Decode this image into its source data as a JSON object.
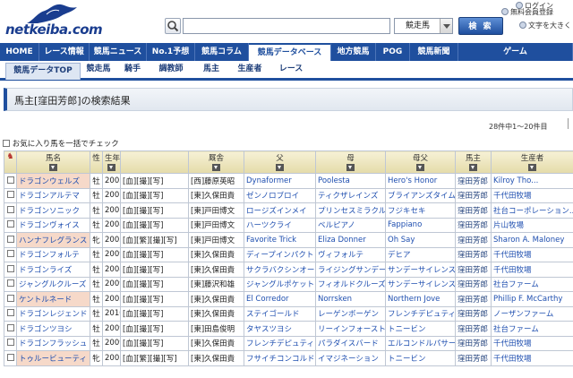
{
  "header": {
    "logo_text": "netkeiba.com",
    "search_placeholder": "",
    "search_select": "競走馬",
    "search_button": "検 索",
    "login_link": "ログイン",
    "member_link": "無料会員登録",
    "font_link": "文字を大きく"
  },
  "main_nav": [
    {
      "label": "HOME",
      "width": 44
    },
    {
      "label": "レース情報",
      "width": 56
    },
    {
      "label": "競馬ニュース",
      "width": 64
    },
    {
      "label": "No.1予想",
      "width": 54
    },
    {
      "label": "競馬コラム",
      "width": 60
    },
    {
      "label": "競馬データベース",
      "width": 92,
      "active": true
    },
    {
      "label": "地方競馬",
      "width": 50
    },
    {
      "label": "POG",
      "width": 38
    },
    {
      "label": "競馬新聞",
      "width": 54
    },
    {
      "label": "ゲーム",
      "width": 128
    }
  ],
  "sub_nav": [
    {
      "label": "競馬データTOP",
      "width": 84,
      "active": true
    },
    {
      "label": "競走馬",
      "width": 40
    },
    {
      "label": "騎手",
      "width": 36
    },
    {
      "label": "調教師",
      "width": 50
    },
    {
      "label": "馬主",
      "width": 40
    },
    {
      "label": "生産者",
      "width": 46
    },
    {
      "label": "レース",
      "width": 46
    }
  ],
  "page_title": "馬主[窪田芳郎]の検索結果",
  "count_text": "28件中1～20件目",
  "fav_check_label": "お気に入り馬を一括でチェック",
  "columns": [
    "馬名",
    "性",
    "生年",
    "",
    "厩舎",
    "父",
    "母",
    "母父",
    "馬主",
    "生産者"
  ],
  "rows": [
    {
      "name": "ドラゴンウェルズ",
      "sex": "牡",
      "year": "2003",
      "links": "[血][撮][写]",
      "trainer": "[西]藤原英昭",
      "sire": "Dynaformer",
      "dam": "Poolesta",
      "damsire": "Hero's Honor",
      "owner": "窪田芳郎",
      "breeder": "Kilroy Tho...",
      "mare_bg": true
    },
    {
      "name": "ドラゴンアルテマ",
      "sex": "牡",
      "year": "2007",
      "links": "[血][撮][写]",
      "trainer": "[東]久保田貴",
      "sire": "ゼンノロブロイ",
      "dam": "ティクザレインズ",
      "damsire": "ブライアンズタイム",
      "owner": "窪田芳郎",
      "breeder": "千代田牧場",
      "mare_bg": false
    },
    {
      "name": "ドラゴンソニック",
      "sex": "牡",
      "year": "2007",
      "links": "[血][撮][写]",
      "trainer": "[東]戸田博文",
      "sire": "ロージズインメイ",
      "dam": "プリンセスミラクル",
      "damsire": "フジキセキ",
      "owner": "窪田芳郎",
      "breeder": "社台コーポレーション...",
      "mare_bg": false
    },
    {
      "name": "ドラゴンヴォイス",
      "sex": "牡",
      "year": "2008",
      "links": "[血][撮][写]",
      "trainer": "[東]戸田博文",
      "sire": "ハーツクライ",
      "dam": "ベルピアノ",
      "damsire": "Fappiano",
      "owner": "窪田芳郎",
      "breeder": "片山牧場",
      "mare_bg": false
    },
    {
      "name": "ハンナフレグランス",
      "sex": "牝",
      "year": "2003",
      "links": "[血][繁][撮][写]",
      "trainer": "[東]戸田博文",
      "sire": "Favorite Trick",
      "dam": "Eliza Donner",
      "damsire": "Oh Say",
      "owner": "窪田芳郎",
      "breeder": "Sharon A. Maloney",
      "mare_bg": true
    },
    {
      "name": "ドラゴンフォルテ",
      "sex": "牡",
      "year": "2009",
      "links": "[血][撮][写]",
      "trainer": "[東]久保田貴",
      "sire": "ディープインパクト",
      "dam": "ヴィフォルテ",
      "damsire": "デヒア",
      "owner": "窪田芳郎",
      "breeder": "千代田牧場",
      "mare_bg": false
    },
    {
      "name": "ドラゴンライズ",
      "sex": "牡",
      "year": "2008",
      "links": "[血][撮][写]",
      "trainer": "[東]久保田貴",
      "sire": "サクラバクシンオー",
      "dam": "ライジングサンデー",
      "damsire": "サンデーサイレンス",
      "owner": "窪田芳郎",
      "breeder": "千代田牧場",
      "mare_bg": false
    },
    {
      "name": "ジャングルクルーズ",
      "sex": "牡",
      "year": "2009",
      "links": "[血][撮][写]",
      "trainer": "[東]藤沢和雄",
      "sire": "ジャングルポケット",
      "dam": "フィオルドクルーズ",
      "damsire": "サンデーサイレンス",
      "owner": "窪田芳郎",
      "breeder": "社台ファーム",
      "mare_bg": false
    },
    {
      "name": "ケントルネード",
      "sex": "牡",
      "year": "2003",
      "links": "[血][撮][写]",
      "trainer": "[東]久保田貴",
      "sire": "El Corredor",
      "dam": "Norrsken",
      "damsire": "Northern Jove",
      "owner": "窪田芳郎",
      "breeder": "Phillip F. McCarthy",
      "mare_bg": true
    },
    {
      "name": "ドラゴンレジェンド",
      "sex": "牡",
      "year": "2010",
      "links": "[血][撮][写]",
      "trainer": "[東]久保田貴",
      "sire": "ステイゴールド",
      "dam": "レーゲンボーゲン",
      "damsire": "フレンチデピュティ",
      "owner": "窪田芳郎",
      "breeder": "ノーザンファーム",
      "mare_bg": false
    },
    {
      "name": "ドラゴンツヨシ",
      "sex": "牡",
      "year": "2009",
      "links": "[血][撮][写]",
      "trainer": "[東]田島俊明",
      "sire": "タヤスツヨシ",
      "dam": "リーインフォースト",
      "damsire": "トニービン",
      "owner": "窪田芳郎",
      "breeder": "社台ファーム",
      "mare_bg": false
    },
    {
      "name": "ドラゴンフラッシュ",
      "sex": "牡",
      "year": "2009",
      "links": "[血][撮][写]",
      "trainer": "[東]久保田貴",
      "sire": "フレンチデピュティ",
      "dam": "パラダイスバード",
      "damsire": "エルコンドルパサー",
      "owner": "窪田芳郎",
      "breeder": "千代田牧場",
      "mare_bg": false
    },
    {
      "name": "トゥルービューティ",
      "sex": "牝",
      "year": "2003",
      "links": "[血][繁][撮][写]",
      "trainer": "[東]久保田貴",
      "sire": "フサイチコンコルド",
      "dam": "イマジネーション",
      "damsire": "トニービン",
      "owner": "窪田芳郎",
      "breeder": "千代田牧場",
      "mare_bg": true
    }
  ],
  "colors": {
    "nav_blue": "#1f4f9e",
    "link_blue": "#1f4fb0",
    "header_gold": "#e4dba9",
    "mare_pink": "#f6d9c9"
  }
}
